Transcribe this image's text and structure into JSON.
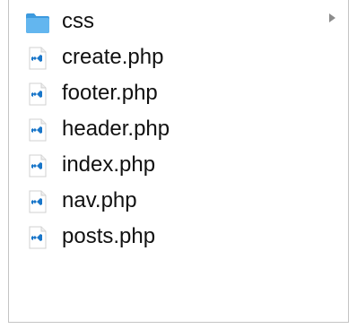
{
  "colors": {
    "folder": "#4fa9e8",
    "vscode_blue": "#1976c9",
    "text": "#111111",
    "chevron": "#8c8c8c"
  },
  "files": [
    {
      "label": "css",
      "icon": "folder-icon",
      "is_folder": true
    },
    {
      "label": "create.php",
      "icon": "vscode-file-icon",
      "is_folder": false
    },
    {
      "label": "footer.php",
      "icon": "vscode-file-icon",
      "is_folder": false
    },
    {
      "label": "header.php",
      "icon": "vscode-file-icon",
      "is_folder": false
    },
    {
      "label": "index.php",
      "icon": "vscode-file-icon",
      "is_folder": false
    },
    {
      "label": "nav.php",
      "icon": "vscode-file-icon",
      "is_folder": false
    },
    {
      "label": "posts.php",
      "icon": "vscode-file-icon",
      "is_folder": false
    }
  ]
}
